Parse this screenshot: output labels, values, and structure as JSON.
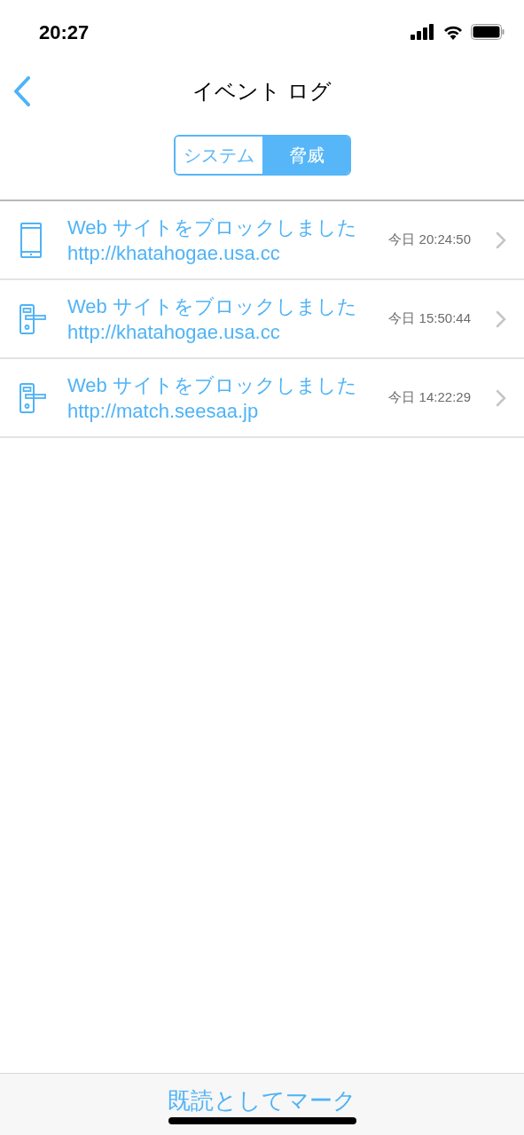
{
  "status_bar": {
    "time": "20:27"
  },
  "nav": {
    "title": "イベント ログ"
  },
  "segments": [
    {
      "label": "システム",
      "selected": false
    },
    {
      "label": "脅威",
      "selected": true
    }
  ],
  "events": [
    {
      "kind": "phone",
      "title": "Web サイトをブロックしました",
      "url": "http://khatahogae.usa.cc",
      "time": "今日 20:24:50"
    },
    {
      "kind": "lock",
      "title": "Web サイトをブロックしました",
      "url": "http://khatahogae.usa.cc",
      "time": "今日 15:50:44"
    },
    {
      "kind": "lock",
      "title": "Web サイトをブロックしました",
      "url": "http://match.seesaa.jp",
      "time": "今日 14:22:29"
    }
  ],
  "footer": {
    "action": "既読としてマーク"
  }
}
